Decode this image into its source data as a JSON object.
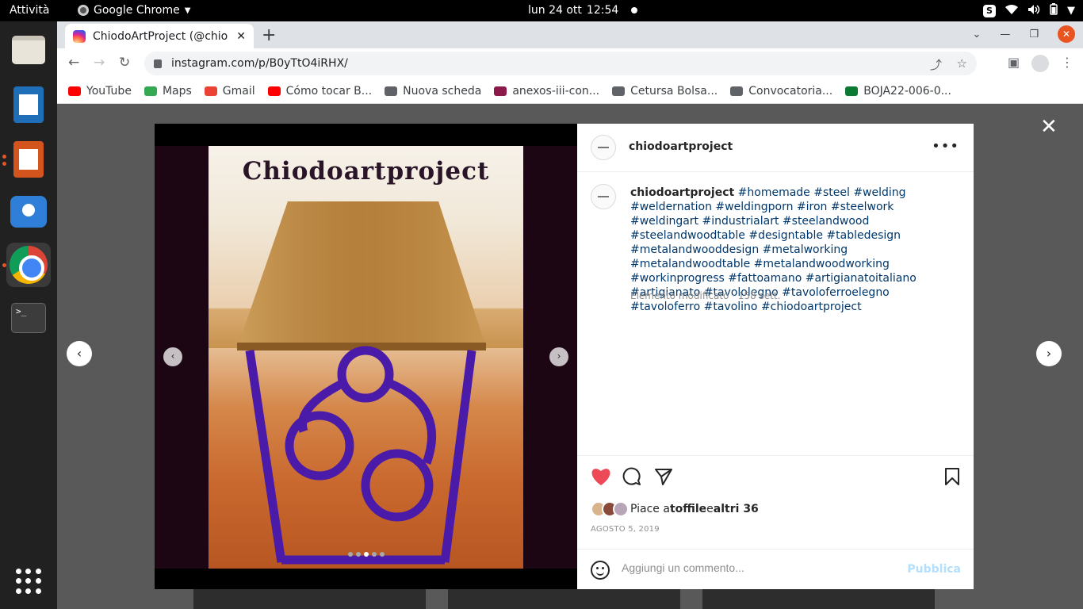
{
  "topbar": {
    "activities": "Attività",
    "app_name": "Google Chrome",
    "date": "lun 24 ott",
    "time": "12:54"
  },
  "browser": {
    "tab_title": "ChiodoArtProject (@chio",
    "url": "instagram.com/p/B0yTtO4iRHX/",
    "bookmarks": [
      {
        "label": "YouTube",
        "color": "#ff0000"
      },
      {
        "label": "Maps",
        "color": "#34a853"
      },
      {
        "label": "Gmail",
        "color": "#ea4335"
      },
      {
        "label": "Cómo tocar B...",
        "color": "#ff0000"
      },
      {
        "label": "Nuova scheda",
        "color": "#5f6368"
      },
      {
        "label": "anexos-iii-con...",
        "color": "#8b1a4a"
      },
      {
        "label": "Cetursa Bolsa...",
        "color": "#5f6368"
      },
      {
        "label": "Convocatoria...",
        "color": "#5f6368"
      },
      {
        "label": "BOJA22-006-0...",
        "color": "#0a7a33"
      }
    ]
  },
  "post": {
    "image_text": "Chiodoartproject",
    "username": "chiodoartproject",
    "caption_user": "chiodoartproject",
    "caption_tags": " #homemade #steel #welding #weldernation #weldingporn #iron #steelwork #weldingart #industrialart #steelandwood #steelandwoodtable #designtable #tabledesign #metalandwooddesign #metalworking #metalandwoodtable #metalandwoodworking #workinprogress #fattoamano #artigianatoitaliano #artigianato #tavololegno #tavoloferroelegno #tavoloferro #tavolino #chiodoartproject",
    "caption_meta": "Elemento modificato · 158 sett.",
    "likes_prefix": "Piace a ",
    "likes_user": "toffile",
    "likes_joiner": " e ",
    "likes_others": "altri 36",
    "date": "AGOSTO 5, 2019",
    "comment_placeholder": "Aggiungi un commento...",
    "publish_label": "Pubblica",
    "carousel_total": 5,
    "carousel_active": 3,
    "liked": true,
    "like_color": "#ed4956"
  }
}
